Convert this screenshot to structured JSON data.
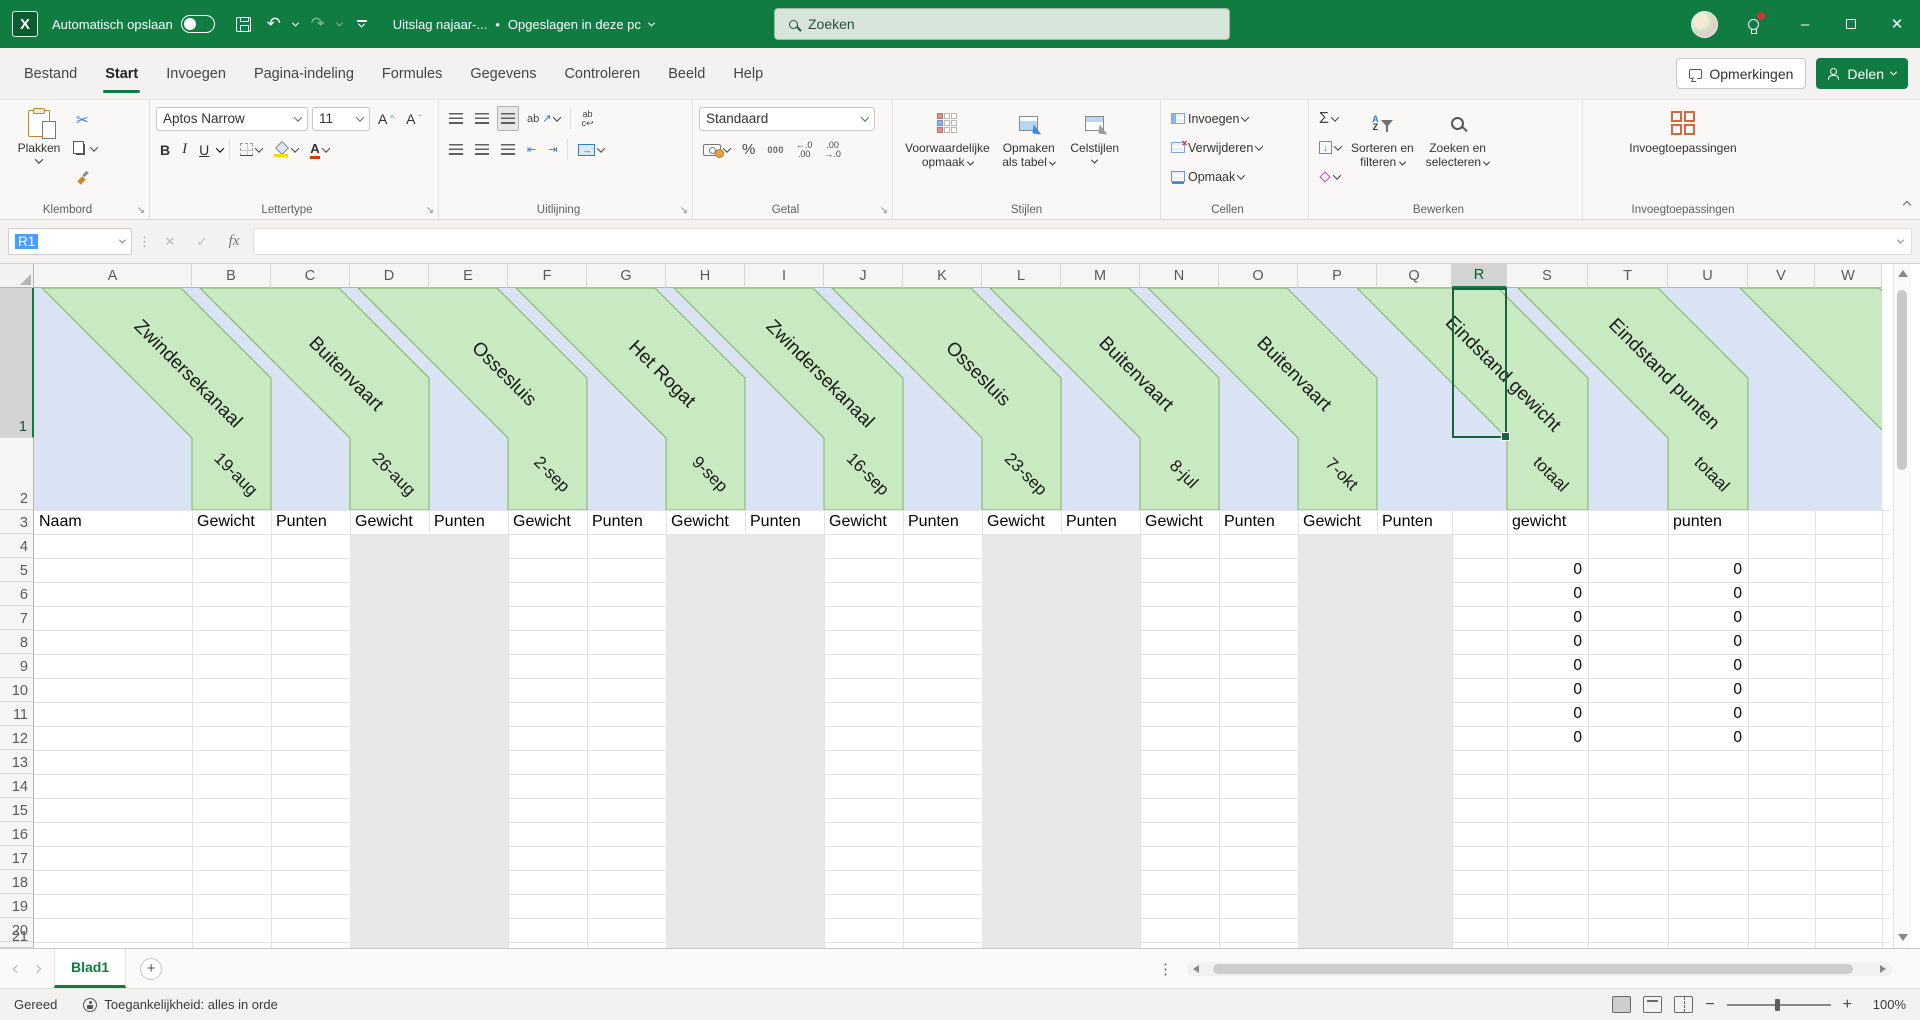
{
  "titlebar": {
    "autosave_label": "Automatisch opslaan",
    "autosave_state": "off",
    "doc_title": "Uitslag najaar-...",
    "separator": "•",
    "doc_status": "Opgeslagen in deze pc",
    "search_placeholder": "Zoeken"
  },
  "menu": {
    "tabs": [
      {
        "label": "Bestand"
      },
      {
        "label": "Start",
        "active": true
      },
      {
        "label": "Invoegen"
      },
      {
        "label": "Pagina-indeling"
      },
      {
        "label": "Formules"
      },
      {
        "label": "Gegevens"
      },
      {
        "label": "Controleren"
      },
      {
        "label": "Beeld"
      },
      {
        "label": "Help"
      }
    ],
    "comments_label": "Opmerkingen",
    "share_label": "Delen"
  },
  "ribbon": {
    "clipboard": {
      "label": "Klembord",
      "paste": "Plakken"
    },
    "font": {
      "label": "Lettertype",
      "name": "Aptos Narrow",
      "size": "11",
      "bold": "B",
      "italic": "I",
      "underline": "U"
    },
    "alignment": {
      "label": "Uitlijning",
      "orientation": "ab",
      "wrap_a": "ab",
      "wrap_b": "c"
    },
    "number": {
      "label": "Getal",
      "format": "Standaard",
      "percent": "%",
      "thousands": "000",
      "dec_inc_a": "←.0",
      "dec_inc_b": ".00",
      "dec_dec_a": ".00",
      "dec_dec_b": "→.0"
    },
    "styles": {
      "label": "Stijlen",
      "conditional": {
        "a": "Voorwaardelijke",
        "b": "opmaak"
      },
      "table": {
        "a": "Opmaken",
        "b": "als tabel"
      },
      "cellstyles": "Celstijlen"
    },
    "cells": {
      "label": "Cellen",
      "insert": "Invoegen",
      "del": "Verwijderen",
      "format": "Opmaak"
    },
    "editing": {
      "label": "Bewerken",
      "sort": {
        "a": "Sorteren en",
        "b": "filteren"
      },
      "find": {
        "a": "Zoeken en",
        "b": "selecteren"
      }
    },
    "addins": {
      "label": "Invoegtoepassingen",
      "button": "Invoegtoepassingen"
    }
  },
  "formula_bar": {
    "name_box": "R1",
    "fx": "fx",
    "formula_value": ""
  },
  "sheet": {
    "columns": [
      "A",
      "B",
      "C",
      "D",
      "E",
      "F",
      "G",
      "H",
      "I",
      "J",
      "K",
      "L",
      "M",
      "N",
      "O",
      "P",
      "Q",
      "R",
      "S",
      "T",
      "U",
      "V",
      "W"
    ],
    "visible_rows": 21,
    "selected": {
      "column": "R",
      "row": 1
    },
    "bands": [
      {
        "venue": "Zwindersekanaal",
        "date": "19-aug",
        "col": "B"
      },
      {
        "venue": "Buitenvaart",
        "date": "26-aug",
        "col": "D"
      },
      {
        "venue": "Ossesluis",
        "date": "2-sep",
        "col": "F"
      },
      {
        "venue": "Het Rogat",
        "date": "9-sep",
        "col": "H"
      },
      {
        "venue": "Zwindersekanaal",
        "date": "16-sep",
        "col": "J"
      },
      {
        "venue": "Ossesluis",
        "date": "23-sep",
        "col": "L"
      },
      {
        "venue": "Buitenvaart",
        "date": "8-jul",
        "col": "N"
      },
      {
        "venue": "Buitenvaart",
        "date": "7-okt",
        "col": "P"
      },
      {
        "venue": "Eindstand gewicht",
        "date": "totaal",
        "col": "S"
      },
      {
        "venue": "Eindstand punten",
        "date": "totaal",
        "col": "U"
      }
    ],
    "row3_labels": {
      "A": "Naam",
      "B": "Gewicht",
      "C": "Punten",
      "D": "Gewicht",
      "E": "Punten",
      "F": "Gewicht",
      "G": "Punten",
      "H": "Gewicht",
      "I": "Punten",
      "J": "Gewicht",
      "K": "Punten",
      "L": "Gewicht",
      "M": "Punten",
      "N": "Gewicht",
      "O": "Punten",
      "P": "Gewicht",
      "Q": "Punten",
      "S": "gewicht",
      "U": "punten"
    },
    "zeros": {
      "columns": [
        "S",
        "U"
      ],
      "rows": [
        5,
        6,
        7,
        8,
        9,
        10,
        11,
        12
      ],
      "value": "0"
    },
    "shaded_pairs": [
      [
        "D",
        "E"
      ],
      [
        "H",
        "I"
      ],
      [
        "L",
        "M"
      ],
      [
        "P",
        "Q"
      ]
    ],
    "colors": {
      "band_green": "#c9e9c3",
      "band_stroke": "#7fb269",
      "bg_blue": "#dae3f3",
      "shade_gray": "#e7e7e7",
      "selection": "#17643d",
      "accent": "#107c41"
    }
  },
  "sheet_tabs": {
    "tabs": [
      {
        "label": "Blad1",
        "active": true
      }
    ]
  },
  "status_bar": {
    "ready": "Gereed",
    "accessibility": "Toegankelijkheid: alles in orde",
    "zoom": "100%"
  }
}
